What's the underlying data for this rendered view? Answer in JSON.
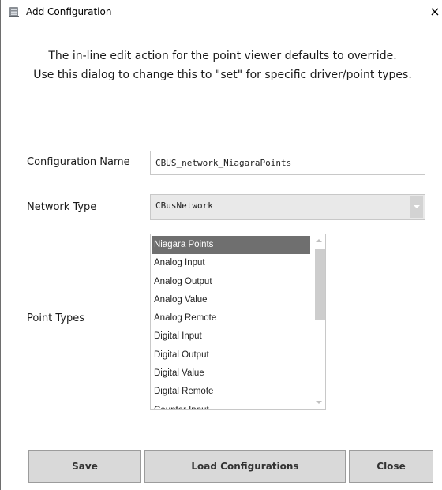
{
  "window": {
    "title": "Add Configuration",
    "close_glyph": "×",
    "icon": "app-icon"
  },
  "message": {
    "line1": "The in-line edit action for the point viewer defaults to override.",
    "line2": "Use this dialog to change this to \"set\" for specific driver/point types."
  },
  "form": {
    "config_name_label": "Configuration Name",
    "config_name_value": "CBUS_network_NiagaraPoints",
    "network_type_label": "Network Type",
    "network_type_value": "CBusNetwork",
    "point_types_label": "Point Types"
  },
  "point_types": {
    "items": [
      "Niagara Points",
      "Analog Input",
      "Analog Output",
      "Analog Value",
      "Analog Remote",
      "Digital Input",
      "Digital Output",
      "Digital Value",
      "Digital Remote",
      "Counter Input"
    ],
    "selected": "Niagara Points"
  },
  "buttons": {
    "save": "Save",
    "load": "Load Configurations",
    "close": "Close"
  },
  "colors": {
    "selection_bg": "#6f6f6f",
    "button_bg": "#d9d9d9",
    "select_bg": "#e9e9e9"
  }
}
